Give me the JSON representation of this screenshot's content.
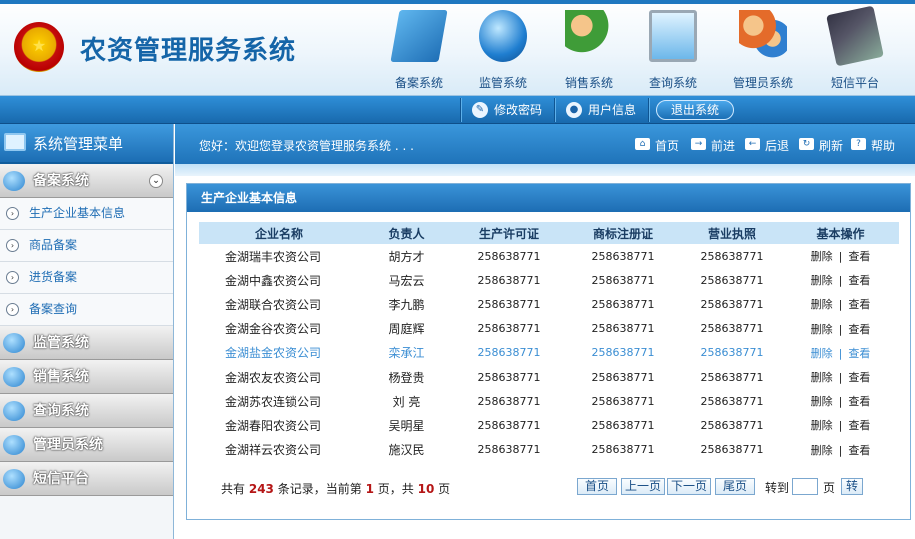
{
  "header": {
    "title": "农资管理服务系统",
    "emblem_glyph": "★",
    "systems": [
      {
        "label": "备案系统",
        "icon": "filing-icon"
      },
      {
        "label": "监管系统",
        "icon": "globe-mail-icon"
      },
      {
        "label": "销售系统",
        "icon": "users-icon"
      },
      {
        "label": "查询系统",
        "icon": "monitor-search-icon"
      },
      {
        "label": "管理员系统",
        "icon": "admin-users-icon"
      },
      {
        "label": "短信平台",
        "icon": "mobile-phone-icon"
      }
    ]
  },
  "toolbar": {
    "change_password": "修改密码",
    "user_info": "用户信息",
    "logout": "退出系统"
  },
  "sidebar": {
    "title": "系统管理菜单",
    "sections": [
      {
        "label": "备案系统",
        "expanded": true,
        "items": [
          "生产企业基本信息",
          "商品备案",
          "进货备案",
          "备案查询"
        ]
      },
      {
        "label": "监管系统"
      },
      {
        "label": "销售系统"
      },
      {
        "label": "查询系统"
      },
      {
        "label": "管理员系统"
      },
      {
        "label": "短信平台"
      }
    ],
    "chevron": "⌄",
    "item_glyph": "›"
  },
  "welcome": {
    "text": "您好：欢迎您登录农资管理服务系统 . . .",
    "buttons": [
      "首页",
      "前进",
      "后退",
      "刷新",
      "帮助"
    ]
  },
  "panel": {
    "title": "生产企业基本信息",
    "columns": [
      "企业名称",
      "负责人",
      "生产许可证",
      "商标注册证",
      "营业执照",
      "基本操作"
    ],
    "rows": [
      {
        "name": "金湖瑞丰农资公司",
        "person": "胡方才",
        "license": "258638771",
        "trademark": "258638771",
        "business": "258638771"
      },
      {
        "name": "金湖中鑫农资公司",
        "person": "马宏云",
        "license": "258638771",
        "trademark": "258638771",
        "business": "258638771"
      },
      {
        "name": "金湖联合农资公司",
        "person": "李九鹏",
        "license": "258638771",
        "trademark": "258638771",
        "business": "258638771"
      },
      {
        "name": "金湖金谷农资公司",
        "person": "周庭辉",
        "license": "258638771",
        "trademark": "258638771",
        "business": "258638771"
      },
      {
        "name": "金湖盐金农资公司",
        "person": "栾承江",
        "license": "258638771",
        "trademark": "258638771",
        "business": "258638771"
      },
      {
        "name": "金湖农友农资公司",
        "person": "杨登贵",
        "license": "258638771",
        "trademark": "258638771",
        "business": "258638771"
      },
      {
        "name": "金湖苏农连锁公司",
        "person": "刘 亮",
        "license": "258638771",
        "trademark": "258638771",
        "business": "258638771"
      },
      {
        "name": "金湖春阳农资公司",
        "person": "吴明星",
        "license": "258638771",
        "trademark": "258638771",
        "business": "258638771"
      },
      {
        "name": "金湖祥云农资公司",
        "person": "施汉民",
        "license": "258638771",
        "trademark": "258638771",
        "business": "258638771"
      }
    ],
    "op_delete": "删除",
    "op_sep": "|",
    "op_view": "查看",
    "highlight_row": 4
  },
  "pager": {
    "prefix": "共有",
    "total": "243",
    "mid1": "条记录，当前第",
    "current": "1",
    "mid2": "页，共",
    "pages": "10",
    "suffix": "页",
    "first": "首页",
    "prev": "上一页",
    "next": "下一页",
    "last": "尾页",
    "goto": "转到",
    "page_unit": "页",
    "go": "转"
  }
}
